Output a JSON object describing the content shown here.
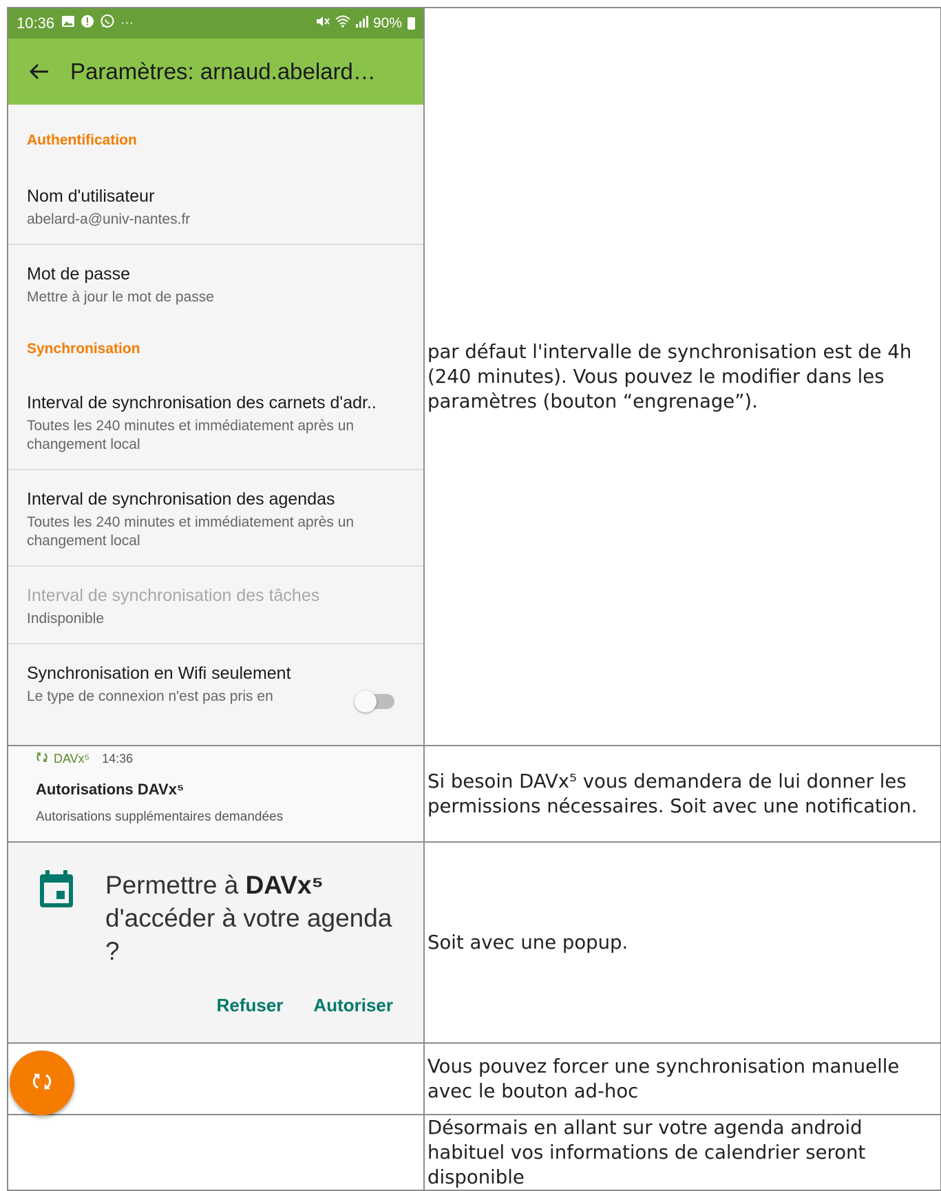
{
  "status_bar": {
    "time": "10:36",
    "extra": "···",
    "battery": "90%"
  },
  "app_bar": {
    "title": "Paramètres: arnaud.abelard…"
  },
  "settings": {
    "auth_header": "Authentification",
    "username": {
      "title": "Nom d'utilisateur",
      "summary": "abelard-a@univ-nantes.fr"
    },
    "password": {
      "title": "Mot de passe",
      "summary": "Mettre à jour le mot de passe"
    },
    "sync_header": "Synchronisation",
    "contacts_interval": {
      "title": "Interval de synchronisation des carnets d'adr..",
      "summary": "Toutes les 240 minutes et immédiatement après un changement local"
    },
    "calendar_interval": {
      "title": "Interval de synchronisation des agendas",
      "summary": "Toutes les 240 minutes et immédiatement après un changement local"
    },
    "tasks_interval": {
      "title": "Interval de synchronisation des tâches",
      "summary": "Indisponible"
    },
    "wifi_only": {
      "title": "Synchronisation en Wifi seulement",
      "summary": "Le type de connexion n'est pas pris en",
      "enabled": false
    }
  },
  "notification": {
    "app": "DAVx⁵",
    "time": "14:36",
    "title": "Autorisations DAVx⁵",
    "body": "Autorisations supplémentaires demandées"
  },
  "dialog": {
    "message_prefix": "Permettre à ",
    "app_name": "DAVx⁵",
    "message_suffix": "d'accéder à votre agenda ?",
    "deny_label": "Refuser",
    "allow_label": "Autoriser"
  },
  "descriptions": {
    "row1": "par défaut l'intervalle de synchronisation est de 4h (240 minutes). Vous pouvez le modifier dans les paramètres (bouton “engrenage”).",
    "row2": "Si besoin DAVx⁵ vous demandera de lui donner les permissions nécessaires. Soit avec une notification.",
    "row3": "Soit avec une popup.",
    "row4": "Vous pouvez forcer une synchronisation manuelle avec le bouton ad-hoc",
    "row5": "Désormais en allant sur votre agenda android habituel vos informations de calendrier seront disponible"
  },
  "colors": {
    "status_bar": "#689f38",
    "app_bar": "#8bc34a",
    "section_header": "#f57c00",
    "dialog_button": "#00796b",
    "calendar_icon": "#00796b",
    "fab": "#f57c00"
  },
  "icons": [
    "back-arrow-icon",
    "gallery-icon",
    "alert-icon",
    "whatsapp-icon",
    "mute-icon",
    "wifi-icon",
    "signal-icon",
    "battery-icon",
    "sync-icon",
    "calendar-icon"
  ]
}
